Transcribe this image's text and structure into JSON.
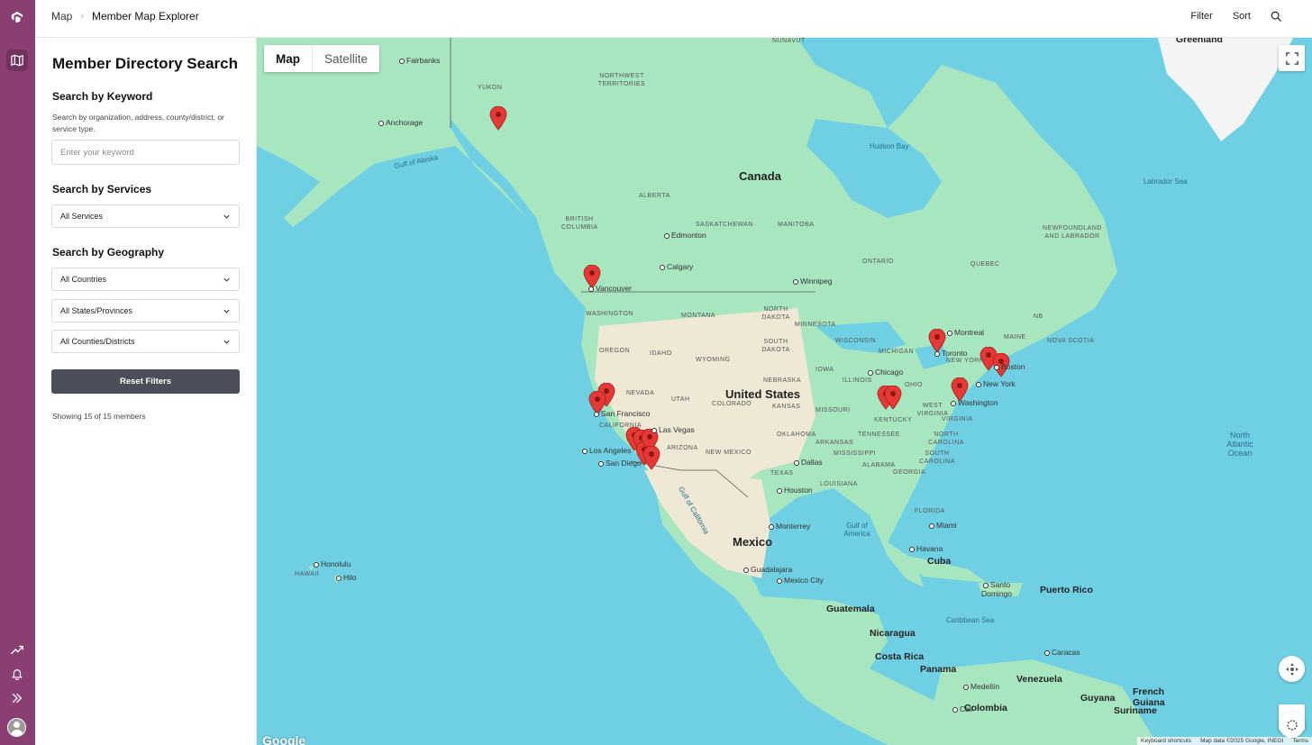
{
  "breadcrumb": {
    "root": "Map",
    "current": "Member Map Explorer"
  },
  "top_actions": {
    "filter": "Filter",
    "sort": "Sort"
  },
  "sidebar": {
    "title": "Member Directory Search",
    "keyword": {
      "heading": "Search by Keyword",
      "help": "Search by organization, address, county/district, or service type.",
      "placeholder": "Enter your keyword",
      "value": ""
    },
    "services": {
      "heading": "Search by Services",
      "selected": "All Services"
    },
    "geography": {
      "heading": "Search by Geography",
      "country": "All Countries",
      "state": "All States/Provinces",
      "county": "All Counties/Districts"
    },
    "reset_label": "Reset Filters",
    "count_text": "Showing 15 of 15 members"
  },
  "map": {
    "type_map": "Map",
    "type_satellite": "Satellite",
    "labels": {
      "greenland": "Greenland",
      "canada": "Canada",
      "united_states": "United States",
      "mexico": "Mexico",
      "cuba": "Cuba",
      "guatemala": "Guatemala",
      "nicaragua": "Nicaragua",
      "costa_rica": "Costa Rica",
      "panama": "Panama",
      "venezuela": "Venezuela",
      "colombia": "Colombia",
      "guyana": "Guyana",
      "suriname": "Suriname",
      "french_guiana": "French Guiana",
      "puerto_rico": "Puerto Rico",
      "nunavut": "NUNAVUT",
      "yukon": "YUKON",
      "nwt": "NORTHWEST TERRITORIES",
      "alberta": "ALBERTA",
      "bc": "BRITISH COLUMBIA",
      "saskatchewan": "SASKATCHEWAN",
      "manitoba": "MANITOBA",
      "ontario": "ONTARIO",
      "quebec": "QUEBEC",
      "newfoundland": "NEWFOUNDLAND AND LABRADOR",
      "nb": "NB",
      "nova_scotia": "NOVA SCOTIA",
      "washington": "WASHINGTON",
      "oregon": "OREGON",
      "california": "CALIFORNIA",
      "nevada": "NEVADA",
      "idaho": "IDAHO",
      "montana": "MONTANA",
      "wyoming": "WYOMING",
      "utah": "UTAH",
      "arizona": "ARIZONA",
      "colorado": "COLORADO",
      "new_mexico": "NEW MEXICO",
      "north_dakota": "NORTH DAKOTA",
      "south_dakota": "SOUTH DAKOTA",
      "nebraska": "NEBRASKA",
      "kansas": "KANSAS",
      "oklahoma": "OKLAHOMA",
      "texas": "TEXAS",
      "minnesota": "MINNESOTA",
      "iowa": "IOWA",
      "missouri": "MISSOURI",
      "arkansas": "ARKANSAS",
      "louisiana": "LOUISIANA",
      "wisconsin": "WISCONSIN",
      "michigan": "MICHIGAN",
      "illinois": "ILLINOIS",
      "ohio": "OHIO",
      "kentucky": "KENTUCKY",
      "tennessee": "TENNESSEE",
      "mississippi": "MISSISSIPPI",
      "alabama": "ALABAMA",
      "georgia": "GEORGIA",
      "florida": "FLORIDA",
      "west_virginia": "WEST VIRGINIA",
      "virginia": "VIRGINIA",
      "north_carolina": "NORTH CAROLINA",
      "south_carolina": "SOUTH CAROLINA",
      "new_york_state": "NEW YORK",
      "maine": "MAINE",
      "hawaii": "HAWAII",
      "hudson_bay": "Hudson Bay",
      "labrador_sea": "Labrador Sea",
      "gulf_alaska": "Gulf of Alaska",
      "gulf_america": "Gulf of America",
      "gulf_california": "Gulf of California",
      "caribbean": "Caribbean Sea",
      "north_atlantic": "North Atlantic Ocean",
      "fairbanks": "Fairbanks",
      "anchorage": "Anchorage",
      "edmonton": "Edmonton",
      "calgary": "Calgary",
      "vancouver": "Vancouver",
      "winnipeg": "Winnipeg",
      "montreal": "Montreal",
      "toronto": "Toronto",
      "boston": "Boston",
      "new_york": "New York",
      "washington_dc": "Washington",
      "chicago": "Chicago",
      "san_francisco": "San Francisco",
      "las_vegas": "Las Vegas",
      "los_angeles": "Los Angeles",
      "san_diego": "San Diego",
      "dallas": "Dallas",
      "houston": "Houston",
      "monterrey": "Monterrey",
      "guadalajara": "Guadalajara",
      "mexico_city": "Mexico City",
      "miami": "Miami",
      "havana": "Havana",
      "santo_domingo": "Santo Domingo",
      "caracas": "Caracas",
      "medellin": "Medellín",
      "cali": "Cali",
      "honolulu": "Honolulu",
      "hilo": "Hilo"
    },
    "attribution": [
      "Keyboard shortcuts",
      "Map data ©2025 Google, INEGI",
      "Terms"
    ],
    "google": "Google",
    "colors": {
      "water": "#6fd0e4",
      "land": "#a8e6c0",
      "land_dry": "#eee8d4",
      "ice": "#f4f4f4",
      "pin": "#e53935"
    }
  }
}
